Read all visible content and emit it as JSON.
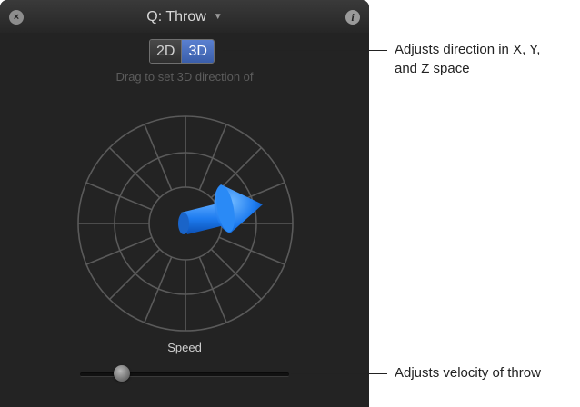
{
  "hud": {
    "title": "Q: Throw",
    "title_dropdown_icon": "chevron-down-icon",
    "close_icon": "close-icon",
    "info_icon": "info-icon",
    "close_glyph": "×",
    "info_glyph": "i",
    "mode_options": [
      "2D",
      "3D"
    ],
    "mode_selected": "3D",
    "hint": "Drag to set 3D direction of",
    "speed_label": "Speed",
    "speed_value_fraction": 0.2,
    "accent_color": "#3f66c0",
    "arrow_color": "#1e7cf0"
  },
  "callouts": {
    "direction_line1": "Adjusts direction in X, Y,",
    "direction_line2": "and Z space",
    "velocity": "Adjusts velocity of throw"
  }
}
